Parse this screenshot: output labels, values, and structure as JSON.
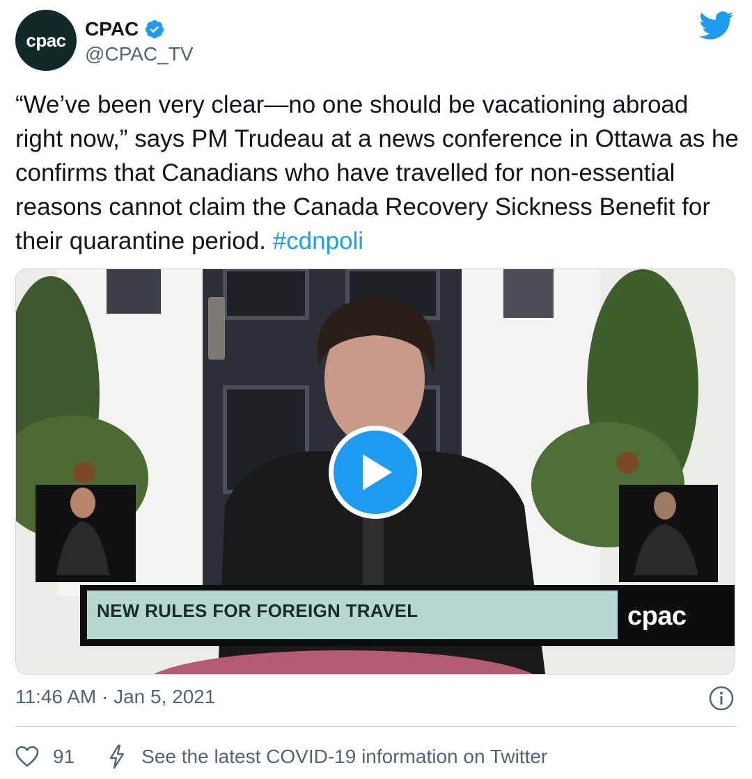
{
  "author": {
    "avatar_text": "cpac",
    "name": "CPAC",
    "handle": "@CPAC_TV",
    "verified": true
  },
  "tweet": {
    "text": "“We’ve been very clear—no one should be vacationing abroad right now,” says PM Trudeau at a news conference in Ottawa as he confirms that Canadians who have travelled for non-essential reasons cannot claim the Canada Recovery Sickness Benefit for their quarantine period. ",
    "hashtag": "#cdnpoli"
  },
  "media": {
    "type": "video",
    "lower_third_title": "NEW RULES FOR FOREIGN TRAVEL",
    "lower_third_logo": "cpac"
  },
  "meta": {
    "timestamp": "11:46 AM · Jan 5, 2021"
  },
  "actions": {
    "like_count": "91",
    "covid_info": "See the latest COVID-19 information on Twitter"
  },
  "colors": {
    "accent": "#1d9bf0",
    "text": "#0f1419",
    "secondary_text": "#536471",
    "border": "#cfd9de",
    "avatar_bg": "#0f2a27"
  },
  "icons": {
    "logo": "twitter-bird-icon",
    "verified": "verified-badge-icon",
    "play": "play-icon",
    "info": "info-icon",
    "like": "heart-icon",
    "covid": "lightning-icon"
  }
}
